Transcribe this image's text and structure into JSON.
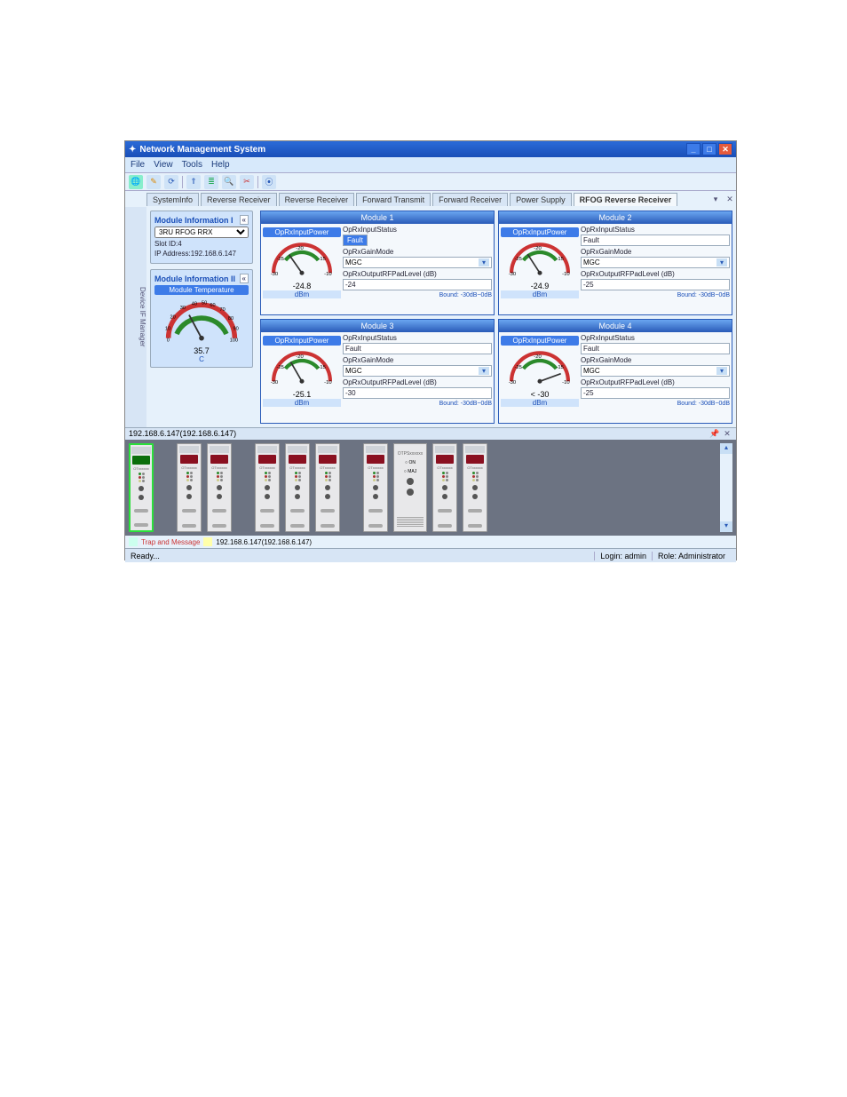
{
  "window": {
    "title": "Network Management System"
  },
  "menu": {
    "file": "File",
    "view": "View",
    "tools": "Tools",
    "help": "Help"
  },
  "tabs": {
    "t0": "SystemInfo",
    "t1": "Reverse Receiver",
    "t2": "Reverse Receiver",
    "t3": "Forward Transmit",
    "t4": "Forward Receiver",
    "t5": "Power Supply",
    "t6": "RFOG Reverse Receiver"
  },
  "side": {
    "panel1": {
      "title": "Module Information I",
      "device": "3RU RFOG RRX",
      "slot": "Slot ID:4",
      "ip": "IP Address:192.168.6.147"
    },
    "panel2": {
      "title": "Module Information II",
      "tempLabel": "Module Temperature",
      "gauge": {
        "t10": "10",
        "t20": "20",
        "t30": "30",
        "t40": "40",
        "t50": "50",
        "t60": "60",
        "t70": "70",
        "t80": "80",
        "t90": "90",
        "t0": "0",
        "t100": "100",
        "value": "35.7",
        "unit": "C"
      }
    }
  },
  "modules": [
    {
      "name": "Module 1",
      "inLabel": "OpRxInputPower",
      "ticks": {
        "n30": "-30",
        "n25": "-25",
        "n20": "-20",
        "n15": "-15",
        "n10": "-10"
      },
      "value": "-24.8",
      "unit": "dBm",
      "status": "Fault",
      "statusHL": true,
      "gain": "MGC",
      "pad": "-24",
      "bound": "Bound: -30dB~0dB",
      "f1": "OpRxInputStatus",
      "f2": "OpRxGainMode",
      "f3": "OpRxOutputRFPadLevel (dB)"
    },
    {
      "name": "Module 2",
      "inLabel": "OpRxInputPower",
      "ticks": {
        "n30": "-30",
        "n25": "-25",
        "n20": "-20",
        "n15": "-15",
        "n10": "-10"
      },
      "value": "-24.9",
      "unit": "dBm",
      "status": "Fault",
      "statusHL": false,
      "gain": "MGC",
      "pad": "-25",
      "bound": "Bound: -30dB~0dB",
      "f1": "OpRxInputStatus",
      "f2": "OpRxGainMode",
      "f3": "OpRxOutputRFPadLevel (dB)"
    },
    {
      "name": "Module 3",
      "inLabel": "OpRxInputPower",
      "ticks": {
        "n30": "-30",
        "n25": "-25",
        "n20": "-20",
        "n15": "-15",
        "n10": "-10"
      },
      "value": "-25.1",
      "unit": "dBm",
      "status": "Fault",
      "statusHL": false,
      "gain": "MGC",
      "pad": "-30",
      "bound": "Bound: -30dB~0dB",
      "f1": "OpRxInputStatus",
      "f2": "OpRxGainMode",
      "f3": "OpRxOutputRFPadLevel (dB)"
    },
    {
      "name": "Module 4",
      "inLabel": "OpRxInputPower",
      "ticks": {
        "n30": "-30",
        "n25": "-25",
        "n20": "-20",
        "n15": "-15",
        "n10": "-10"
      },
      "value": "< -30",
      "unit": "dBm",
      "status": "Fault",
      "statusHL": false,
      "gain": "MGC",
      "pad": "-25",
      "bound": "Bound: -30dB~0dB",
      "f1": "OpRxInputStatus",
      "f2": "OpRxGainMode",
      "f3": "OpRxOutputRFPadLevel (dB)"
    }
  ],
  "strip": {
    "header": "192.168.6.147(192.168.6.147)"
  },
  "msgbar": {
    "left": "Trap and Message",
    "ip": "192.168.6.147(192.168.6.147)"
  },
  "status": {
    "ready": "Ready...",
    "login": "Login: admin",
    "role": "Role: Administrator"
  }
}
